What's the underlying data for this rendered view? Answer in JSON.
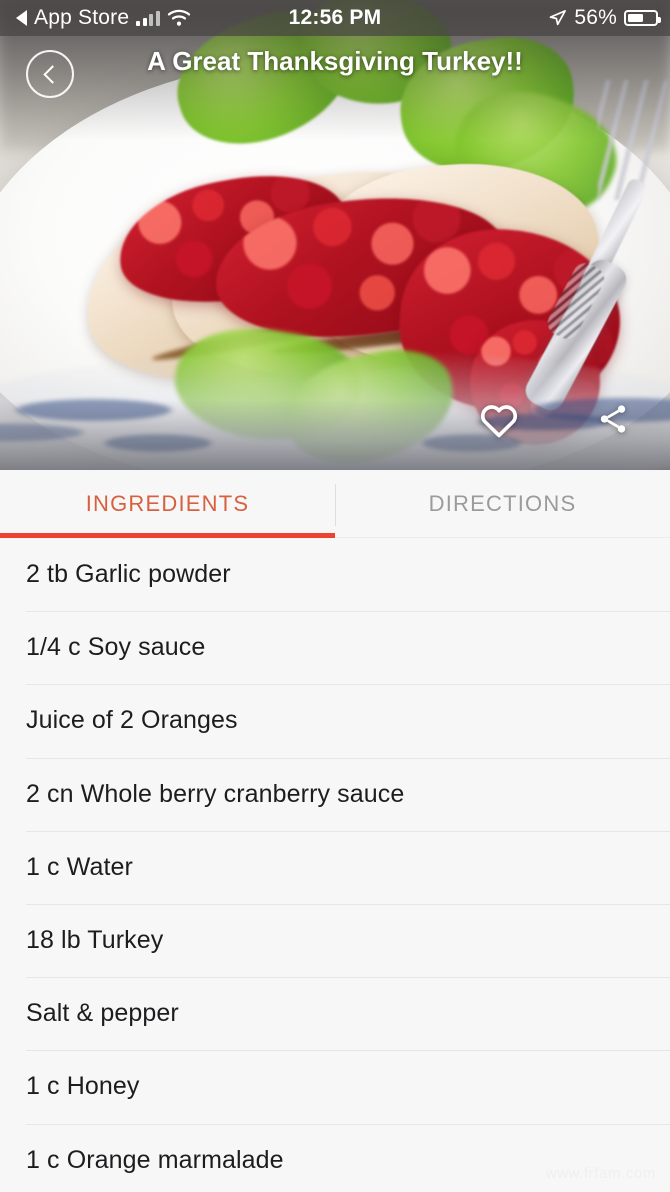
{
  "status_bar": {
    "back_app_label": "App Store",
    "time": "12:56 PM",
    "battery_percent": "56%",
    "battery_level": 56,
    "icons": [
      "back-triangle-icon",
      "signal-bars-icon",
      "wifi-icon",
      "location-arrow-icon",
      "battery-icon"
    ]
  },
  "hero": {
    "title": "A Great Thanksgiving Turkey!!",
    "back_button_icon": "chevron-left-icon",
    "favorite_icon": "heart-icon",
    "share_icon": "share-icon",
    "photo_alt": "Sliced roast turkey breast with cranberry sauce and frisee lettuce on a white plate"
  },
  "tabs": [
    {
      "label": "INGREDIENTS",
      "active": true
    },
    {
      "label": "DIRECTIONS",
      "active": false
    }
  ],
  "ingredients": [
    "2 tb Garlic powder",
    "1/4 c Soy sauce",
    "Juice of 2 Oranges",
    "2 cn Whole berry cranberry sauce",
    "1 c Water",
    "18 lb Turkey",
    "Salt & pepper",
    "1 c Honey",
    "1 c Orange marmalade"
  ],
  "watermark": "www.frfam.com",
  "colors": {
    "accent": "#ef4130",
    "active_tab_text": "#d9603f",
    "inactive_tab_text": "#9b9b9b",
    "list_background": "#f7f7f7",
    "text": "#1d1d1f"
  }
}
